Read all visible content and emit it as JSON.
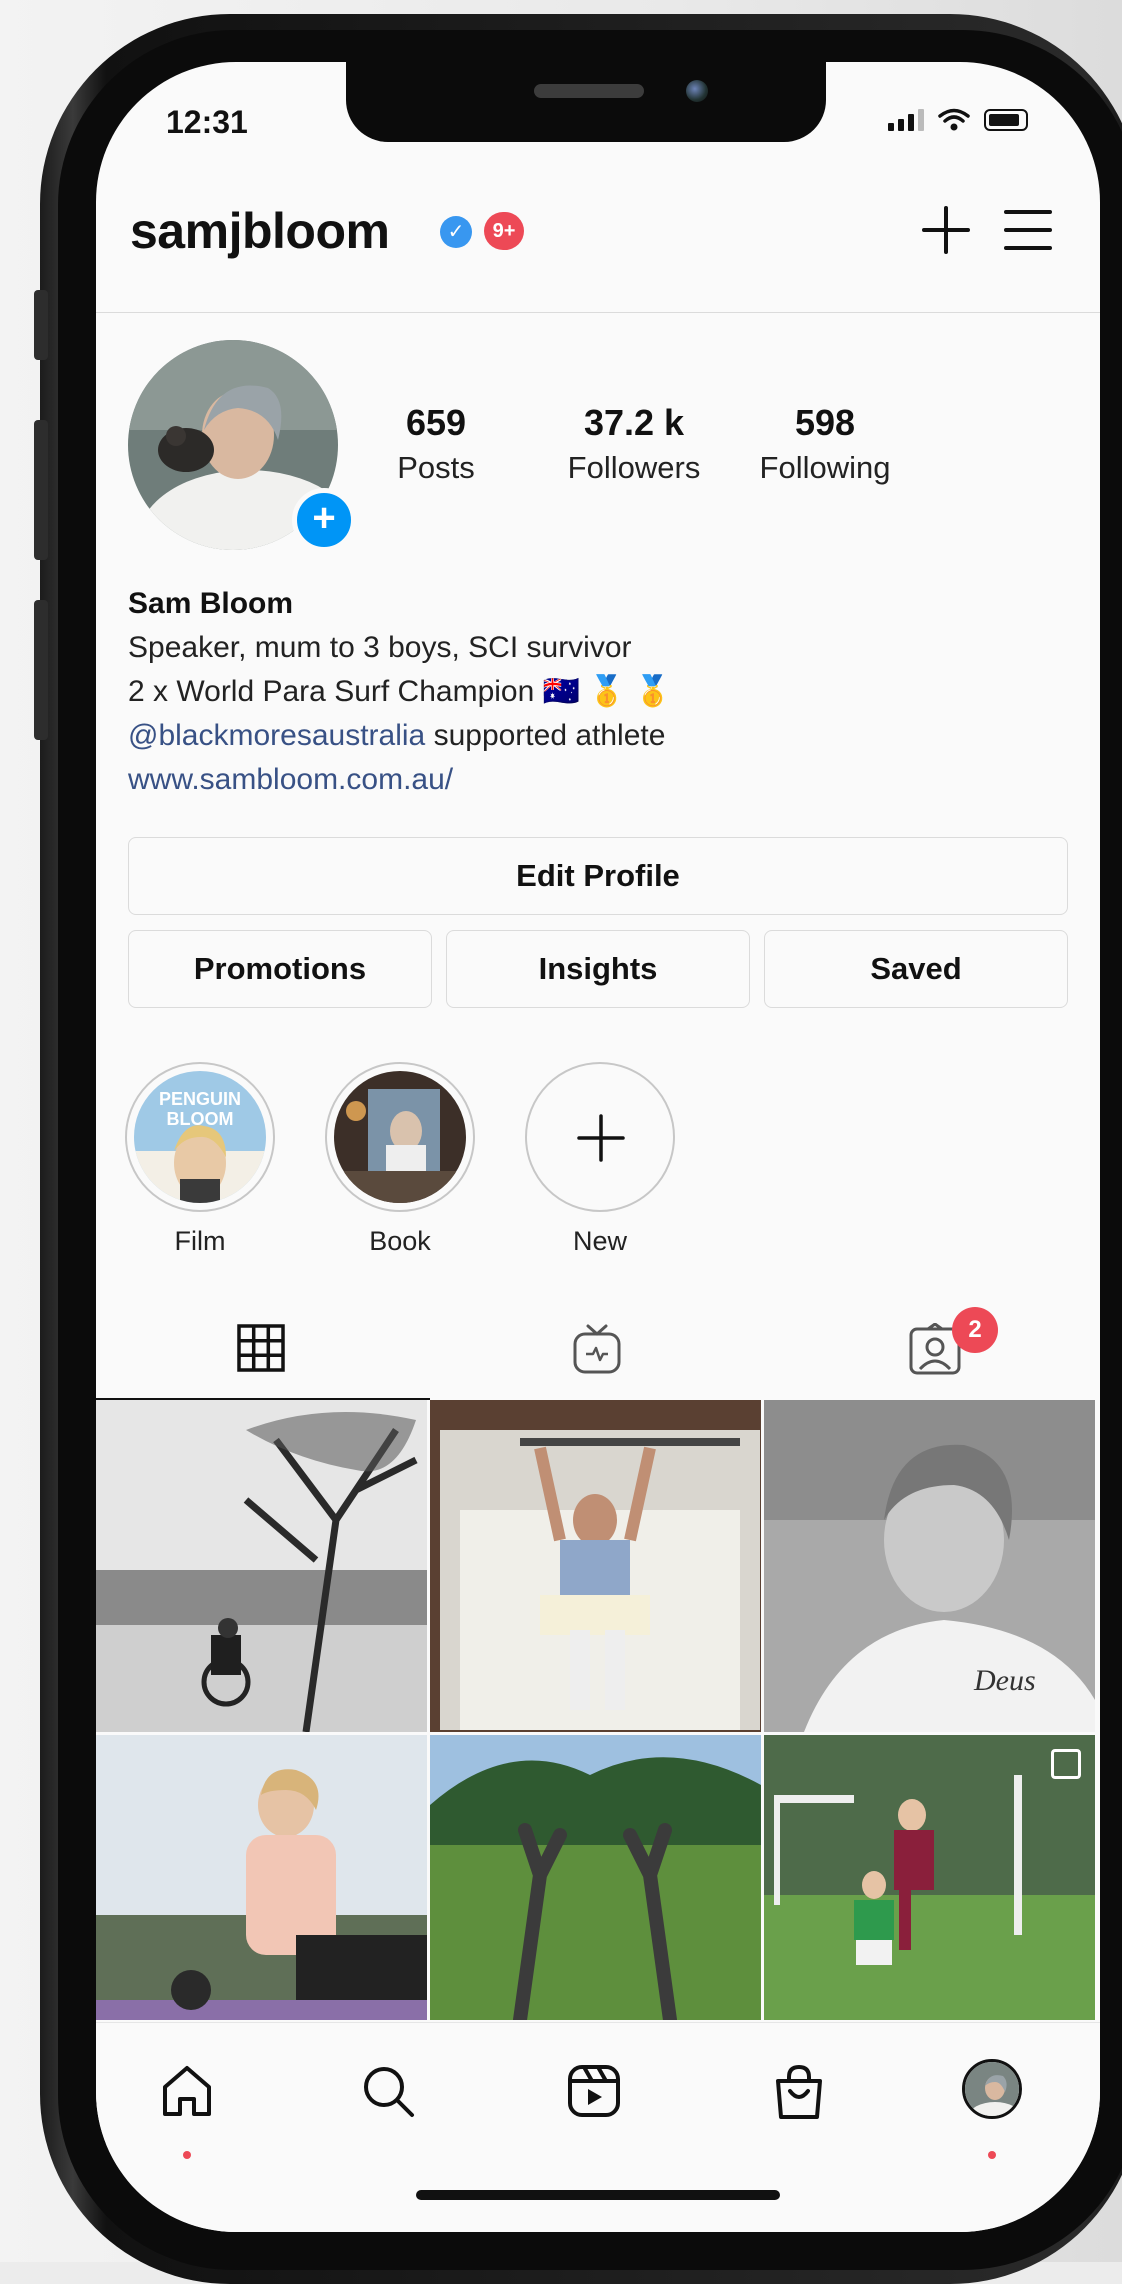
{
  "status_bar": {
    "time": "12:31"
  },
  "header": {
    "username": "samjbloom",
    "verified": true,
    "notifications_badge": "9+"
  },
  "profile": {
    "stats": [
      {
        "value": "659",
        "label": "Posts"
      },
      {
        "value": "37.2 k",
        "label": "Followers"
      },
      {
        "value": "598",
        "label": "Following"
      }
    ],
    "name": "Sam Bloom",
    "bio_line1": "Speaker, mum to 3 boys, SCI survivor",
    "bio_line2": "2 x World Para Surf Champion 🇦🇺 🥇 🥇",
    "bio_mention": "@blackmoresaustralia",
    "bio_mention_suffix": " supported athlete",
    "website": "www.sambloom.com.au/"
  },
  "buttons": {
    "edit_profile": "Edit Profile",
    "promotions": "Promotions",
    "insights": "Insights",
    "saved": "Saved"
  },
  "highlights": [
    {
      "label": "Film",
      "cover_text": "PENGUIN BLOOM"
    },
    {
      "label": "Book"
    },
    {
      "label": "New"
    }
  ],
  "tabs": {
    "tagged_badge": "2"
  },
  "colors": {
    "accent": "#0095f6",
    "badge": "#ed4956",
    "link": "#385185"
  }
}
